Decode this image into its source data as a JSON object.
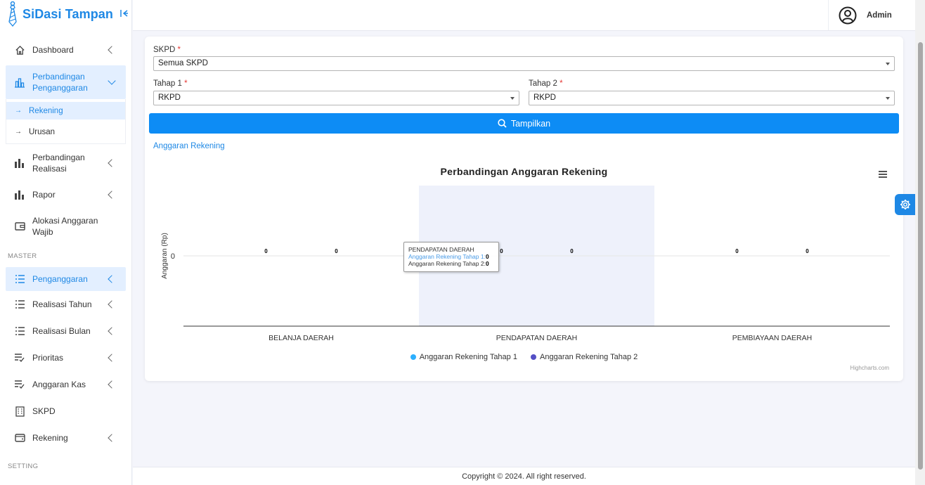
{
  "sidebar": {
    "brand": "SiDasi Tampan",
    "items": [
      {
        "label": "Dashboard"
      },
      {
        "label": "Perbandingan Penganggaran",
        "active": true,
        "sub": [
          {
            "label": "Rekening",
            "active": true
          },
          {
            "label": "Urusan"
          }
        ]
      },
      {
        "label": "Perbandingan Realisasi"
      },
      {
        "label": "Rapor"
      },
      {
        "label": "Alokasi Anggaran Wajib"
      }
    ],
    "section_master": "MASTER",
    "master_items": [
      {
        "label": "Penganggaran",
        "active": true
      },
      {
        "label": "Realisasi Tahun"
      },
      {
        "label": "Realisasi Bulan"
      },
      {
        "label": "Prioritas"
      },
      {
        "label": "Anggaran Kas"
      },
      {
        "label": "SKPD"
      },
      {
        "label": "Rekening"
      }
    ],
    "section_setting": "SETTING"
  },
  "topbar": {
    "user": "Admin"
  },
  "form": {
    "skpd_label": "SKPD",
    "skpd_value": "Semua SKPD",
    "tahap1_label": "Tahap 1",
    "tahap1_value": "RKPD",
    "tahap2_label": "Tahap 2",
    "tahap2_value": "RKPD",
    "required_mark": "*",
    "button_label": "Tampilkan",
    "link_label": "Anggaran Rekening"
  },
  "chart_data": {
    "type": "bar",
    "title": "Perbandingan Anggaran Rekening",
    "ylabel": "Anggaran (Rp)",
    "categories": [
      "BELANJA DAERAH",
      "PENDAPATAN DAERAH",
      "PEMBIAYAAN DAERAH"
    ],
    "series": [
      {
        "name": "Anggaran Rekening Tahap 1",
        "values": [
          0,
          0,
          0
        ],
        "color": "#2caffe"
      },
      {
        "name": "Anggaran Rekening Tahap 2",
        "values": [
          0,
          0,
          0
        ],
        "color": "#544fc5"
      }
    ],
    "y_ticks": [
      "0"
    ],
    "legend_position": "bottom-center",
    "highlighted_category": "PENDAPATAN DAERAH",
    "credits": "Highcharts.com"
  },
  "tooltip": {
    "title": "PENDAPATAN DAERAH",
    "line1_label": "Anggaran Rekening Tahap 1:",
    "line1_value": "0",
    "line2_label": "Anggaran Rekening Tahap 2:",
    "line2_value": "0"
  },
  "footer": {
    "text": "Copyright © 2024. All right reserved."
  },
  "colors": {
    "accent": "#1e88e5",
    "button": "#0d8cf5",
    "series1": "#2caffe",
    "series2": "#544fc5"
  }
}
